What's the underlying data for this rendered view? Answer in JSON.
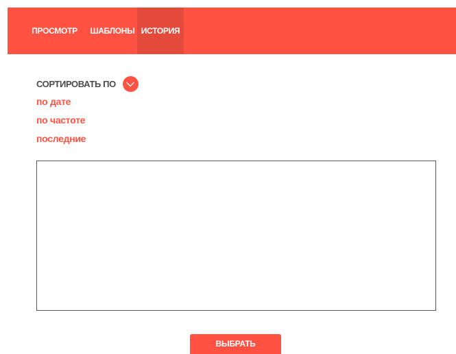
{
  "nav": {
    "tabs": [
      {
        "label": "ПРОСМОТР",
        "active": false
      },
      {
        "label": "ШАБЛОНЫ",
        "active": false
      },
      {
        "label": "ИСТОРИЯ",
        "active": true
      }
    ]
  },
  "sort": {
    "label": "СОРТИРОВАТЬ ПО",
    "toggle_icon": "chevron-down-icon",
    "options": [
      {
        "label": "по дате"
      },
      {
        "label": "по частоте"
      },
      {
        "label": "последние"
      }
    ]
  },
  "history": {
    "items": []
  },
  "actions": {
    "select_label": "ВЫБРАТЬ"
  },
  "colors": {
    "accent": "#ff5242",
    "accent_active": "#e34a3c",
    "text_dark": "#4a4a4a",
    "border": "#555555"
  }
}
